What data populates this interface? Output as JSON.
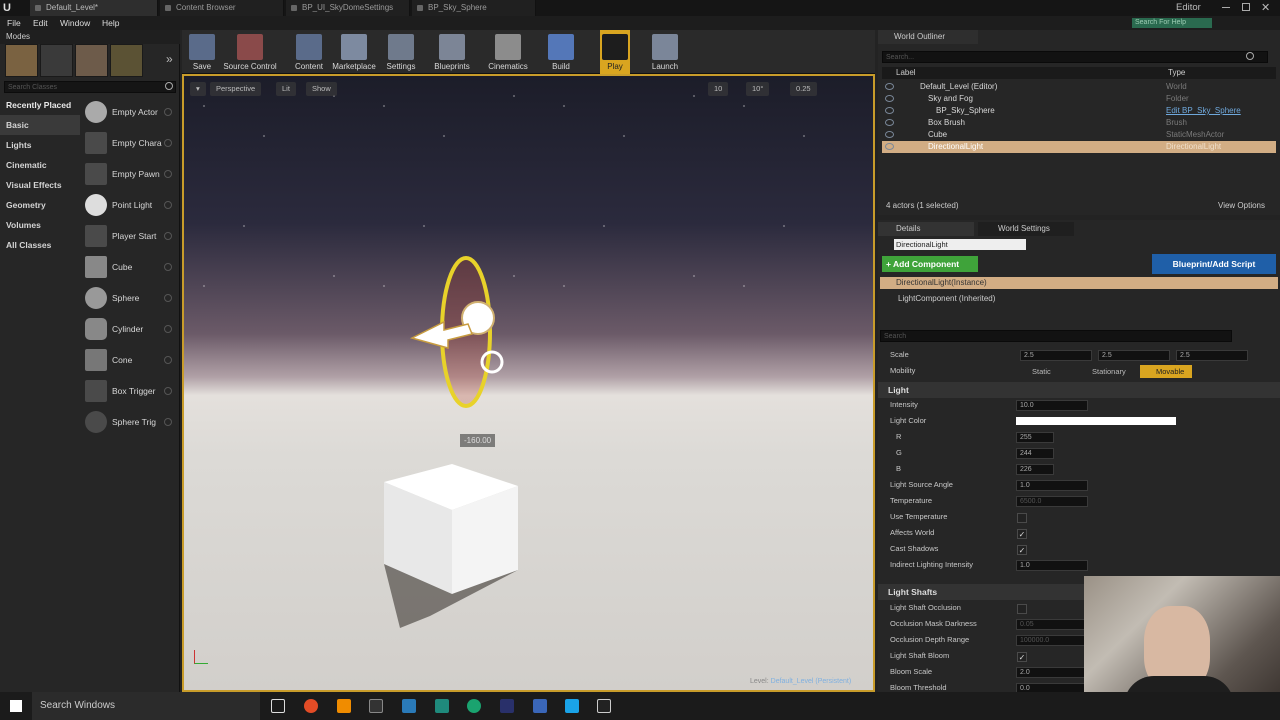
{
  "titlebar": {
    "tabs": [
      "Default_Level*",
      "Content Browser",
      "BP_UI_SkyDomeSettings",
      "BP_Sky_Sphere"
    ],
    "editor_label": "Editor",
    "search_help_placeholder": "Search For Help"
  },
  "menu": [
    "File",
    "Edit",
    "Window",
    "Help"
  ],
  "modes": {
    "title": "Modes",
    "search_placeholder": "Search Classes",
    "categories": [
      "Recently Placed",
      "Basic",
      "Lights",
      "Cinematic",
      "Visual Effects",
      "Geometry",
      "Volumes",
      "All Classes"
    ],
    "items": [
      "Empty Actor",
      "Empty Chara",
      "Empty Pawn",
      "Point Light",
      "Player Start",
      "Cube",
      "Sphere",
      "Cylinder",
      "Cone",
      "Box Trigger",
      "Sphere Trig"
    ]
  },
  "toolbar": [
    "Save",
    "Source Control",
    "Content",
    "Marketplace",
    "Settings",
    "Blueprints",
    "Cinematics",
    "Build",
    "Play",
    "Launch"
  ],
  "viewport": {
    "buttons": [
      "Perspective",
      "Lit",
      "Show"
    ],
    "rotation_readout": "-160.00",
    "level_label": "Level:",
    "level_name": "Default_Level (Persistent)",
    "snap_values": [
      "10",
      "10°",
      "0.25"
    ]
  },
  "outliner": {
    "title": "World Outliner",
    "search_placeholder": "Search...",
    "col_label": "Label",
    "col_type": "Type",
    "rows": [
      {
        "label": "Default_Level (Editor)",
        "type": "World"
      },
      {
        "label": "Sky and Fog",
        "type": "Folder"
      },
      {
        "label": "BP_Sky_Sphere",
        "type": "Edit BP_Sky_Sphere"
      },
      {
        "label": "Box Brush",
        "type": "Brush"
      },
      {
        "label": "Cube",
        "type": "StaticMeshActor"
      },
      {
        "label": "DirectionalLight",
        "type": "DirectionalLight"
      }
    ],
    "count": "4 actors (1 selected)",
    "view_options": "View Options"
  },
  "details": {
    "tabs": [
      "Details",
      "World Settings"
    ],
    "actor_name": "DirectionalLight",
    "add_component": "+ Add Component",
    "blueprint_button": "Blueprint/Add Script",
    "components": [
      "DirectionalLight(Instance)",
      "LightComponent (Inherited)"
    ],
    "search_placeholder": "Search",
    "scale_label": "Scale",
    "scale": [
      "2.5",
      "2.5",
      "2.5"
    ],
    "mobility_label": "Mobility",
    "mobility": [
      "Static",
      "Stationary",
      "Movable"
    ],
    "light_section": "Light",
    "light_props": {
      "intensity_label": "Intensity",
      "intensity": "10.0",
      "light_color_label": "Light Color",
      "r_label": "R",
      "r": "255",
      "g_label": "G",
      "g": "244",
      "b_label": "B",
      "b": "226",
      "source_angle_label": "Light Source Angle",
      "source_angle": "1.0",
      "temperature_label": "Temperature",
      "temperature": "6500.0",
      "use_temp_label": "Use Temperature",
      "affects_world_label": "Affects World",
      "cast_shadows_label": "Cast Shadows",
      "indirect_label": "Indirect Lighting Intensity",
      "indirect": "1.0"
    },
    "shafts_section": "Light Shafts",
    "shaft_props": {
      "occlusion_label": "Light Shaft Occlusion",
      "mask_label": "Occlusion Mask Darkness",
      "mask": "0.05",
      "depth_label": "Occlusion Depth Range",
      "depth": "100000.0",
      "bloom_label": "Light Shaft Bloom",
      "bloom_scale_label": "Bloom Scale",
      "bloom_scale": "2.0",
      "bloom_threshold_label": "Bloom Threshold",
      "bloom_threshold": "0.0"
    }
  },
  "taskbar": {
    "search": "Search Windows"
  },
  "colors": {
    "accent": "#d9a520",
    "selection": "#d2ad84",
    "add_component": "#3fa33a",
    "blueprint": "#1f5fa8"
  }
}
